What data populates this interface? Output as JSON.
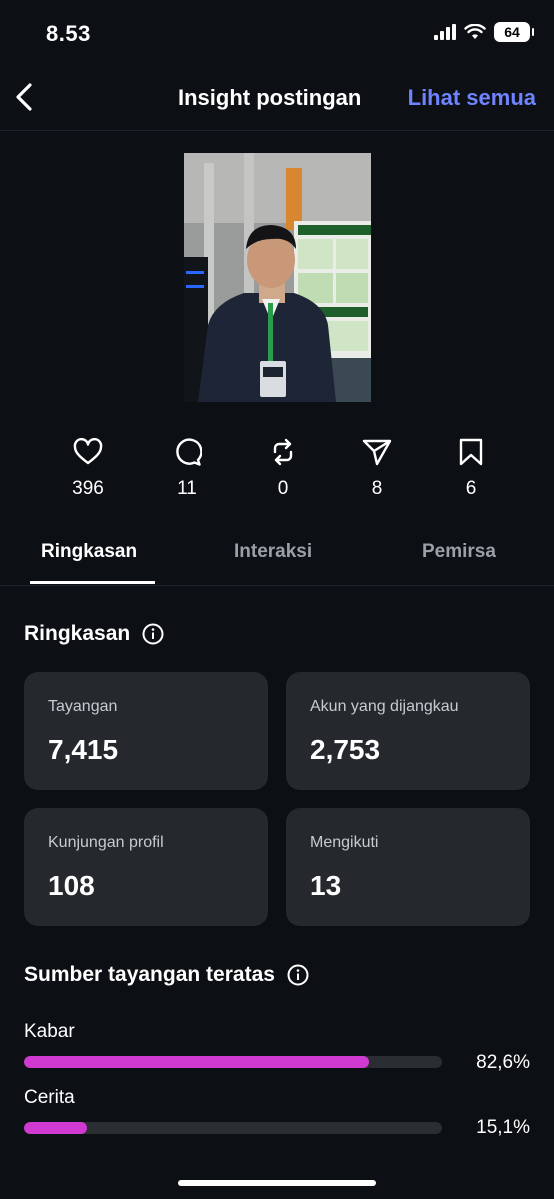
{
  "status": {
    "time": "8.53",
    "battery": "64"
  },
  "nav": {
    "title": "Insight postingan",
    "link": "Lihat semua"
  },
  "stats": [
    {
      "icon": "heart-icon",
      "value": "396"
    },
    {
      "icon": "comment-icon",
      "value": "11"
    },
    {
      "icon": "repost-icon",
      "value": "0"
    },
    {
      "icon": "share-icon",
      "value": "8"
    },
    {
      "icon": "bookmark-icon",
      "value": "6"
    }
  ],
  "tabs": [
    "Ringkasan",
    "Interaksi",
    "Pemirsa"
  ],
  "summary": {
    "title": "Ringkasan",
    "cards": [
      {
        "label": "Tayangan",
        "value": "7,415"
      },
      {
        "label": "Akun yang dijangkau",
        "value": "2,753"
      },
      {
        "label": "Kunjungan profil",
        "value": "108"
      },
      {
        "label": "Mengikuti",
        "value": "13"
      }
    ]
  },
  "sources": {
    "title": "Sumber tayangan teratas",
    "items": [
      {
        "label": "Kabar",
        "percent": "82,6%",
        "fraction": 0.826
      },
      {
        "label": "Cerita",
        "percent": "15,1%",
        "fraction": 0.151
      }
    ]
  },
  "colors": {
    "accent_link": "#7083ff",
    "bar_fill": "#d13ad1",
    "background": "#0c1014",
    "card": "#25292e"
  }
}
